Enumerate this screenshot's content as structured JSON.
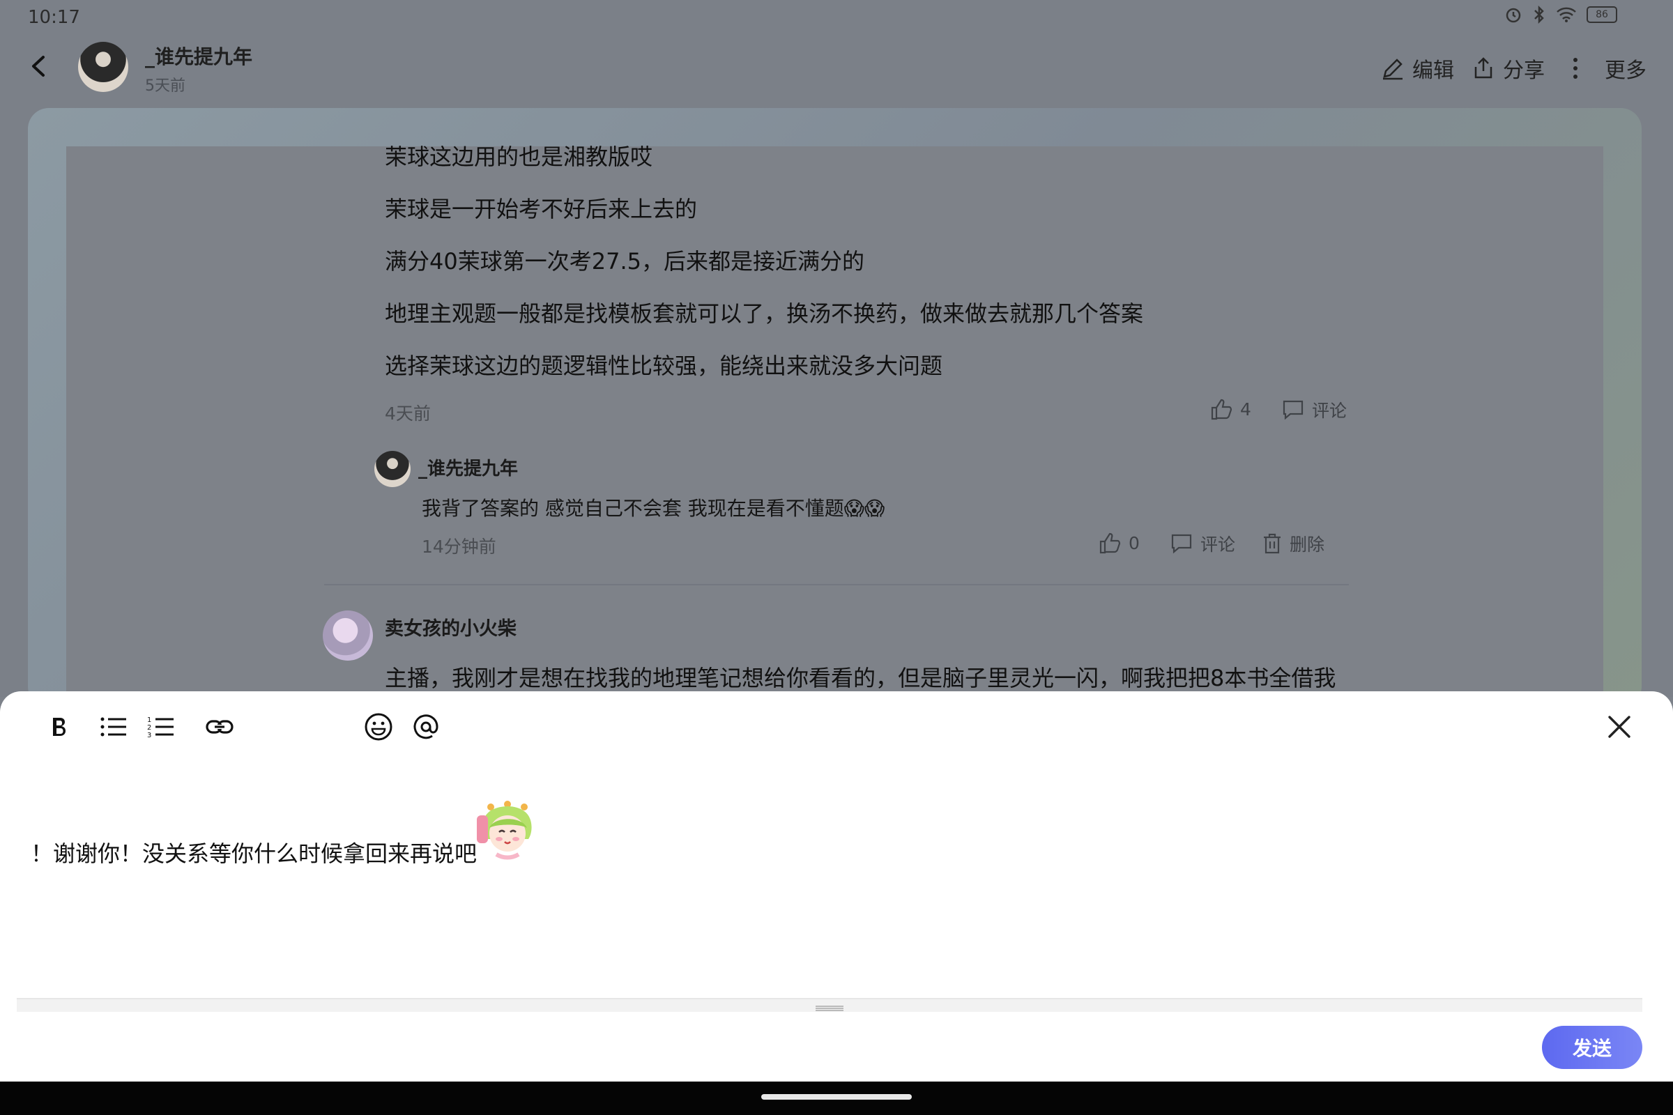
{
  "status_bar": {
    "time": "10:17",
    "battery": "86"
  },
  "header": {
    "author": "_谁先提九年",
    "time": "5天前",
    "edit_label": "编辑",
    "share_label": "分享",
    "more_label": "更多"
  },
  "comment": {
    "lines": [
      "茉球这边用的也是湘教版哎",
      "茉球是一开始考不好后来上去的",
      "满分40茉球第一次考27.5，后来都是接近满分的",
      "地理主观题一般都是找模板套就可以了，换汤不换药，做来做去就那几个答案",
      "选择茉球这边的题逻辑性比较强，能绕出来就没多大问题"
    ],
    "time": "4天前",
    "likes": "4",
    "comment_label": "评论"
  },
  "reply": {
    "author": "_谁先提九年",
    "text": "我背了答案的 感觉自己不会套 我现在是看不懂题😱😱",
    "time": "14分钟前",
    "likes": "0",
    "comment_label": "评论",
    "delete_label": "删除"
  },
  "next_comment": {
    "author": "卖女孩的小火柴",
    "text": "主播，我刚才是想在找我的地理笔记想给你看看的，但是脑子里灵光一闪，啊我把把8本书全借我"
  },
  "editor": {
    "text": "！谢谢你！没关系等你什么时候拿回来再说吧",
    "send_label": "发送"
  },
  "colors": {
    "accent": "#6470f2",
    "send_gradient_end": "#7a86f5"
  }
}
